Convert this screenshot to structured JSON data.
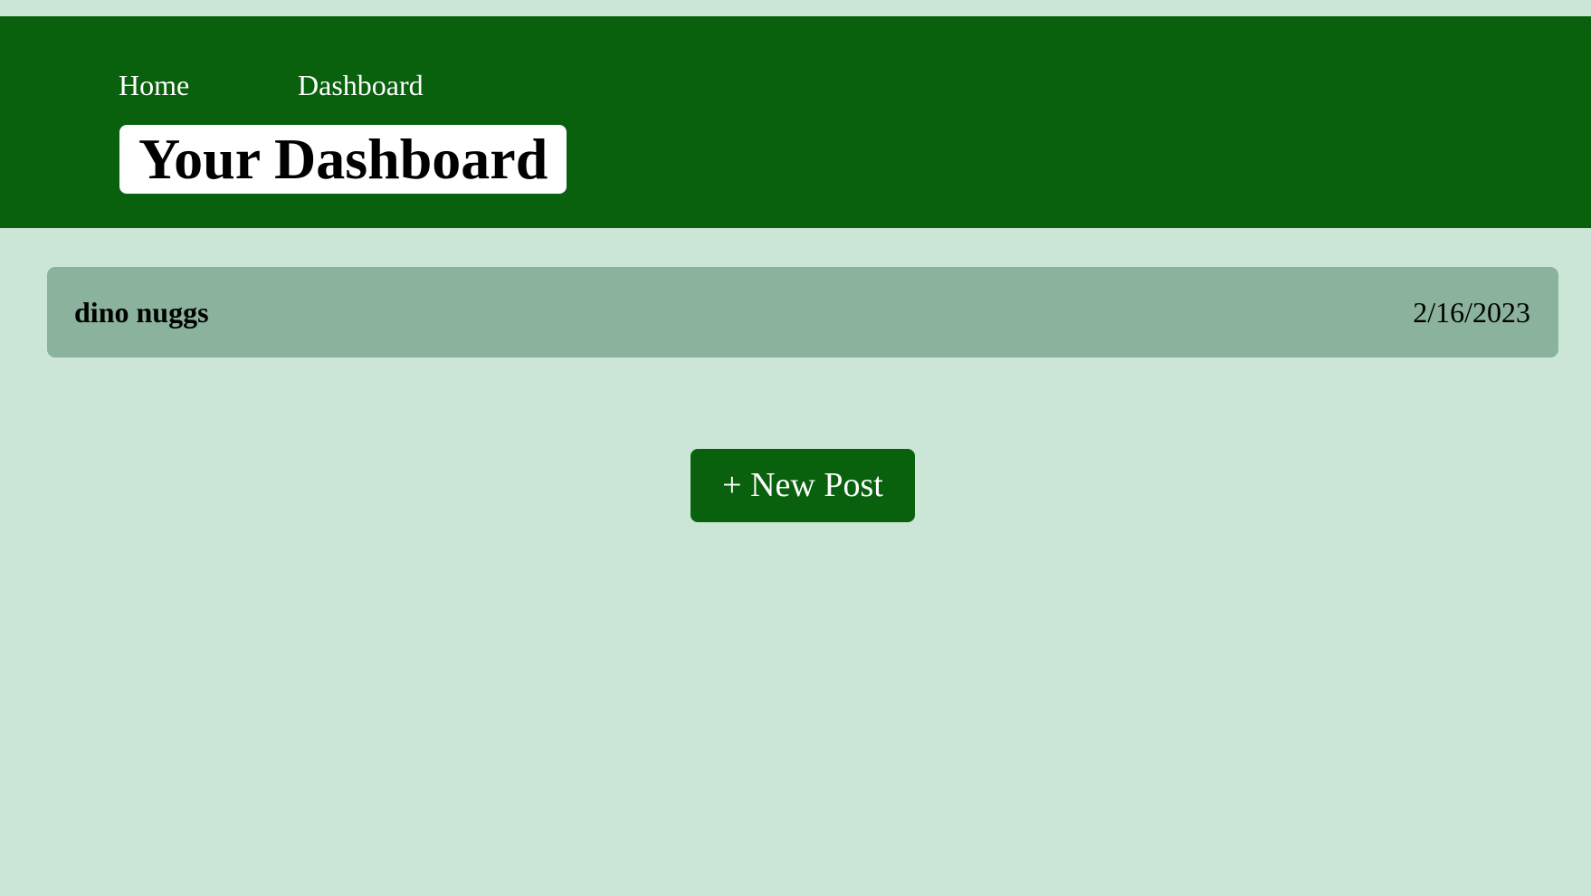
{
  "nav": {
    "items": [
      {
        "label": "Home"
      },
      {
        "label": "Dashboard"
      }
    ]
  },
  "header": {
    "title": "Your Dashboard"
  },
  "posts": [
    {
      "title": "dino nuggs",
      "date": "2/16/2023"
    }
  ],
  "actions": {
    "new_post_label": "+ New Post"
  },
  "colors": {
    "page_background": "#cbe6d6",
    "header_background": "#09610d",
    "post_row_background": "#8ab29c",
    "button_background": "#09610d",
    "title_box_background": "#ffffff"
  }
}
